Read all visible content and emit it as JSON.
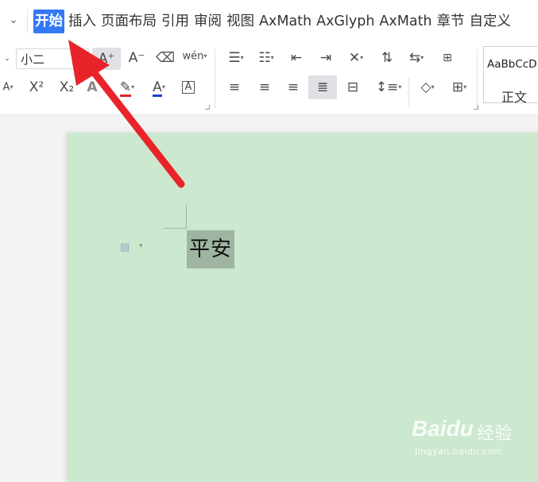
{
  "menubar": {
    "tabs": [
      {
        "label": "开始",
        "active": true
      },
      {
        "label": "插入"
      },
      {
        "label": "页面布局"
      },
      {
        "label": "引用"
      },
      {
        "label": "审阅"
      },
      {
        "label": "视图"
      },
      {
        "label": "AxMath"
      },
      {
        "label": "AxGlyph"
      },
      {
        "label": "AxMath"
      },
      {
        "label": "章节"
      },
      {
        "label": "自定义"
      }
    ],
    "active_color": "#3478f6"
  },
  "ribbon": {
    "font_size_value": "小二",
    "grow_font_glyph": "A⁺",
    "shrink_font_glyph": "A⁻",
    "pinyin_glyph": "wén",
    "superscript_glyph": "X²",
    "subscript_glyph": "X₂",
    "styles": {
      "sample": "AaBbCcD",
      "name": "正文"
    },
    "highlight_color": "#e0252b",
    "font_color": "#1a3fd0"
  },
  "document": {
    "selected_text": "平安",
    "page_color": "#cce8cf",
    "selection_color": "#9fb5a2"
  },
  "annotation": {
    "arrow_color": "#e8242a"
  },
  "watermark": {
    "brand": "Baidu",
    "cn": "经验",
    "url": "jingyan.baidu.com"
  }
}
